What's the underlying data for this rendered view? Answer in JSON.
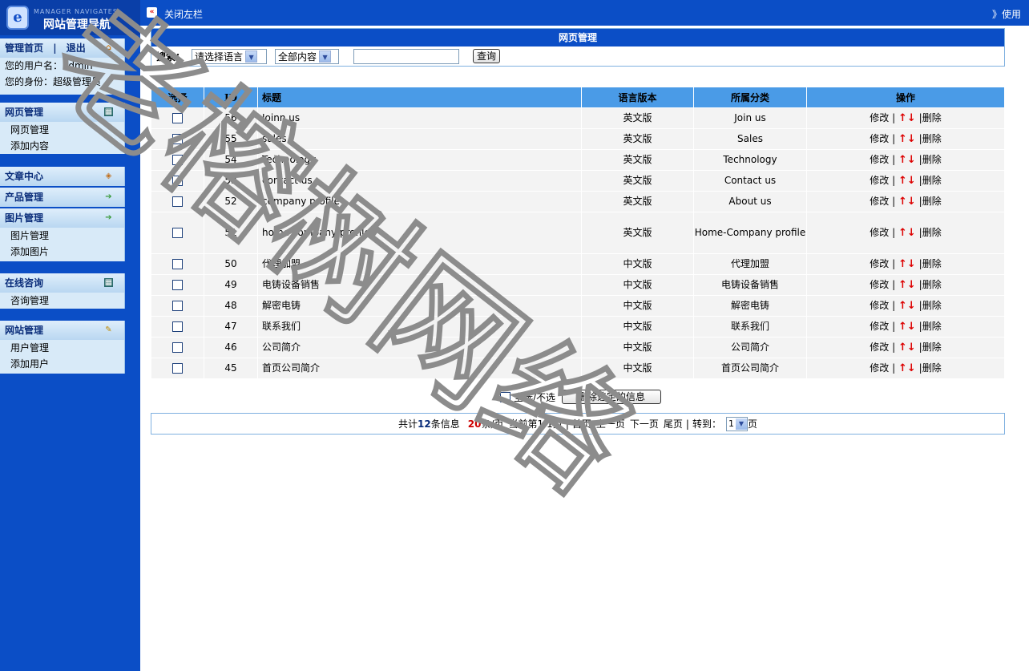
{
  "sidebar": {
    "logo_caption": "MANAGER NAVIGATES",
    "logo_title": "网站管理导航",
    "logo_mark": "e",
    "top": {
      "home": "管理首页",
      "sep": "|",
      "logout": "退出",
      "username": "您的用户名：admin",
      "role": "您的身份：超级管理员"
    },
    "groups": [
      {
        "title": "网页管理",
        "items": [
          "网页管理",
          "添加内容"
        ]
      },
      {
        "title": "文章中心",
        "items": []
      },
      {
        "title": "产品管理",
        "items": []
      },
      {
        "title": "图片管理",
        "items": [
          "图片管理",
          "添加图片"
        ]
      },
      {
        "title": "在线咨询",
        "items": [
          "咨询管理"
        ]
      },
      {
        "title": "网站管理",
        "items": [
          "用户管理",
          "添加用户"
        ]
      }
    ]
  },
  "topbar": {
    "close_left": "关闭左栏",
    "right_text": "》使用"
  },
  "search_panel": {
    "title": "网页管理",
    "label": "搜索：",
    "lang_select": "请选择语言",
    "scope_select": "全部内容",
    "query": "",
    "button": "查询"
  },
  "table": {
    "headers": [
      "选择",
      "ID",
      "标题",
      "语言版本",
      "所属分类",
      "操作"
    ],
    "action_edit": "修改",
    "action_sep": "|",
    "up": "↑",
    "down": "↓",
    "action_delete": "删除",
    "rows": [
      {
        "id": "56",
        "title": "Joinn us",
        "lang": "英文版",
        "cat": "Join us"
      },
      {
        "id": "55",
        "title": "sales",
        "lang": "英文版",
        "cat": "Sales"
      },
      {
        "id": "54",
        "title": "Technology",
        "lang": "英文版",
        "cat": "Technology"
      },
      {
        "id": "53",
        "title": "contact us",
        "lang": "英文版",
        "cat": "Contact us"
      },
      {
        "id": "52",
        "title": "company profile",
        "lang": "英文版",
        "cat": "About us"
      },
      {
        "id": "51",
        "title": "home company profile",
        "lang": "英文版",
        "cat": "Home-Company profile"
      },
      {
        "id": "50",
        "title": "代理加盟",
        "lang": "中文版",
        "cat": "代理加盟"
      },
      {
        "id": "49",
        "title": "电铸设备销售",
        "lang": "中文版",
        "cat": "电铸设备销售"
      },
      {
        "id": "48",
        "title": "解密电铸",
        "lang": "中文版",
        "cat": "解密电铸"
      },
      {
        "id": "47",
        "title": "联系我们",
        "lang": "中文版",
        "cat": "联系我们"
      },
      {
        "id": "46",
        "title": "公司简介",
        "lang": "中文版",
        "cat": "公司简介"
      },
      {
        "id": "45",
        "title": "首页公司简介",
        "lang": "中文版",
        "cat": "首页公司简介"
      }
    ]
  },
  "bulk": {
    "select_all": "全选/不选",
    "delete_selected": "删除选定的信息"
  },
  "pager": {
    "total_prefix": "共计",
    "total": "12",
    "total_suffix": "条信息",
    "per_page": "20",
    "per_page_suffix": "条/页",
    "current": "当前第1/1页",
    "first": "首页",
    "prev": "上一页",
    "next": "下一页",
    "last": "尾页",
    "goto": "转到：",
    "page_value": "1",
    "page_suffix": "页"
  },
  "watermark": "老榕树网络"
}
